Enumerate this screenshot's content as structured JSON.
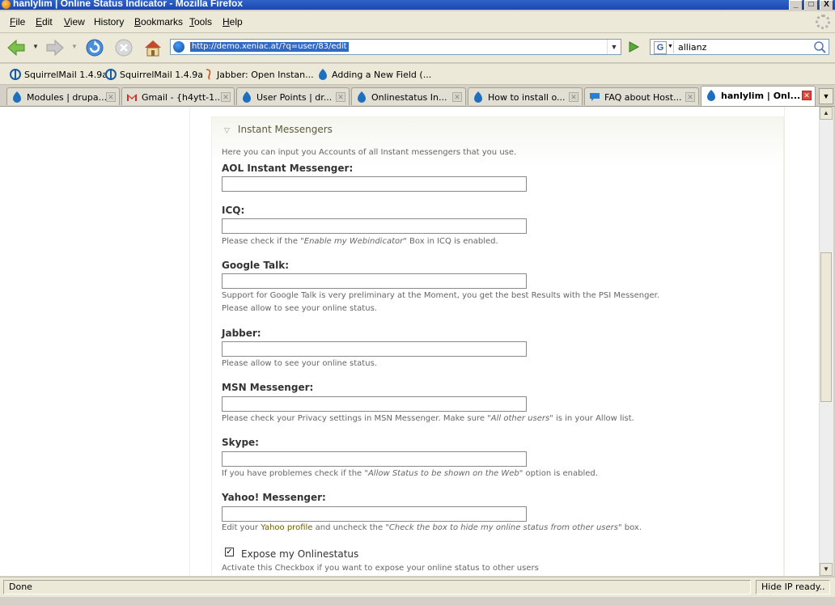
{
  "window": {
    "title": "hanlylim | Online Status Indicator - Mozilla Firefox",
    "controls": [
      "_",
      "□",
      "X"
    ]
  },
  "menu": [
    "File",
    "Edit",
    "View",
    "History",
    "Bookmarks",
    "Tools",
    "Help"
  ],
  "menu_underline": [
    "F",
    "E",
    "V",
    "",
    "B",
    "T",
    "H"
  ],
  "menu_rest": [
    "ile",
    "dit",
    "iew",
    "History",
    "ookmarks",
    "ools",
    "elp"
  ],
  "url": "http://demo.xeniac.at/?q=user/83/edit",
  "search": {
    "engine_letter": "G",
    "value": "allianz"
  },
  "bookmarks": [
    "SquirrelMail 1.4.9a",
    "SquirrelMail 1.4.9a",
    "Jabber: Open Instan...",
    "Adding a New Field (..."
  ],
  "tabs": [
    {
      "label": "Modules | drupa...",
      "icon": "drupal-icon"
    },
    {
      "label": "Gmail - {h4ytt-1...",
      "icon": "gmail-icon"
    },
    {
      "label": "User Points | dr...",
      "icon": "drupal-icon"
    },
    {
      "label": "Onlinestatus In...",
      "icon": "drupal-icon"
    },
    {
      "label": "How to install o...",
      "icon": "drupal-icon"
    },
    {
      "label": "FAQ about Host...",
      "icon": "chat-bubble-icon"
    },
    {
      "label": "hanlylim | Onl...",
      "icon": "drupal-icon",
      "active": true
    }
  ],
  "form": {
    "legend": "Instant Messengers",
    "intro": "Here you can input you Accounts of all Instant messengers that you use.",
    "aol": {
      "label": "AOL Instant Messenger:",
      "value": ""
    },
    "icq": {
      "label": "ICQ:",
      "value": "",
      "desc_pre": "Please check if the ",
      "desc_em": "\"Enable my Webindicator\"",
      "desc_post": " Box in ICQ is enabled."
    },
    "gtalk": {
      "label": "Google Talk:",
      "value": "",
      "desc1": "Support for Google Talk is very preliminary at the Moment, you get the best Results with the PSI Messenger.",
      "desc2": "Please allow to see your online status."
    },
    "jabber": {
      "label": "Jabber:",
      "value": "",
      "desc": "Please allow to see your online status."
    },
    "msn": {
      "label": "MSN Messenger:",
      "value": "",
      "desc_pre": "Please check your Privacy settings in MSN Messenger. Make sure ",
      "desc_em": "\"All other users\"",
      "desc_post": " is in your Allow list."
    },
    "skype": {
      "label": "Skype:",
      "value": "",
      "desc_pre": "If you have problemes check if the ",
      "desc_em": "\"Allow Status to be shown on the Web\"",
      "desc_post": " option is enabled."
    },
    "yahoo": {
      "label": "Yahoo! Messenger:",
      "value": "",
      "desc_pre": "Edit your ",
      "desc_link": "Yahoo profile",
      "desc_mid": " and uncheck the ",
      "desc_em": "\"Check the box to hide my online status from other users\"",
      "desc_post": " box."
    },
    "expose": {
      "label": "Expose my Onlinestatus",
      "checked": true,
      "desc": "Activate this Checkbox if you want to expose your online status to other users"
    }
  },
  "status": {
    "left": "Done",
    "right": "Hide IP ready.."
  }
}
